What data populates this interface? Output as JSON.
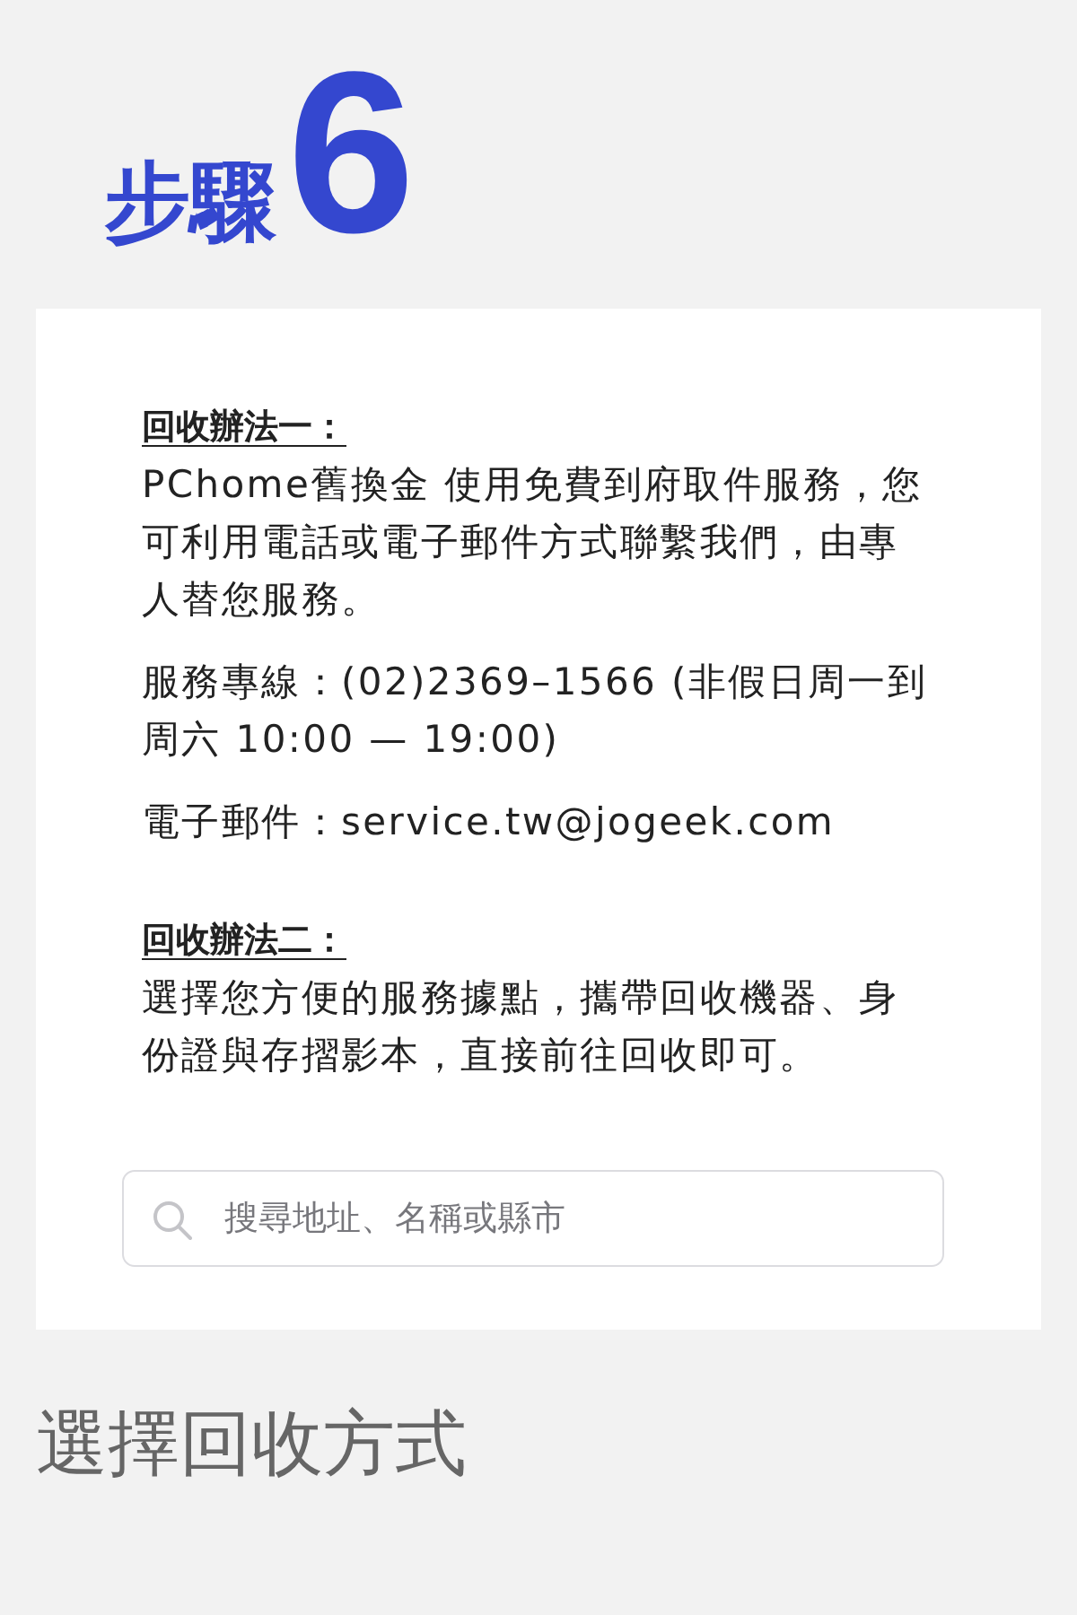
{
  "header": {
    "label": "步驟",
    "number": "6"
  },
  "card": {
    "sections": [
      {
        "title": "回收辦法一：",
        "paragraphs": [
          "PChome舊換金 使用免費到府取件服務，您可利用電話或電子郵件方式聯繫我們，由專人替您服務。",
          "服務專線：(02)2369–1566 (非假日周一到周六 10:00 — 19:00)",
          "電子郵件：service.tw@jogeek.com"
        ]
      },
      {
        "title": "回收辦法二：",
        "paragraphs": [
          "選擇您方便的服務據點，攜帶回收機器、身份證與存摺影本，直接前往回收即可。"
        ]
      }
    ],
    "search": {
      "placeholder": "搜尋地址、名稱或縣市"
    }
  },
  "section_title": "選擇回收方式"
}
